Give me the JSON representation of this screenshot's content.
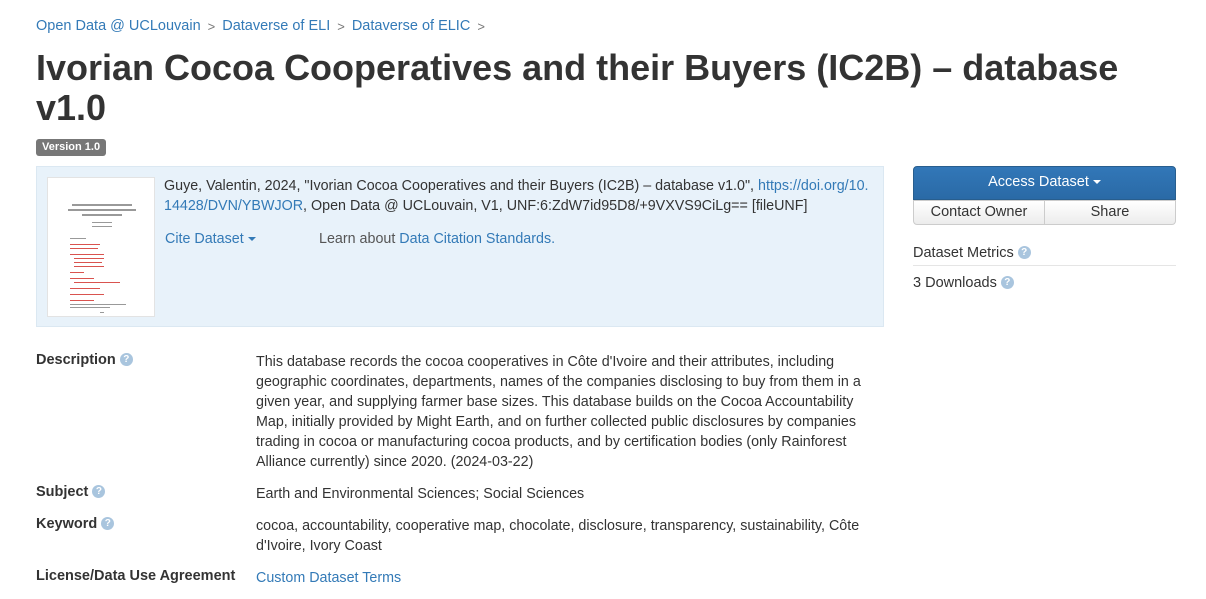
{
  "breadcrumb": [
    {
      "label": "Open Data @ UCLouvain"
    },
    {
      "label": "Dataverse of ELI"
    },
    {
      "label": "Dataverse of ELIC"
    }
  ],
  "breadcrumb_separator": ">",
  "title": "Ivorian Cocoa Cooperatives and their Buyers (IC2B) – database v1.0",
  "version_badge": "Version 1.0",
  "citation": {
    "text_before": "Guye, Valentin, 2024, \"Ivorian Cocoa Cooperatives and their Buyers (IC2B) – database v1.0\", ",
    "doi_link": "https://doi.org/10.14428/DVN/YBWJOR",
    "text_after": ", Open Data @ UCLouvain, V1, UNF:6:ZdW7id95D8/+9VXVS9CiLg== [fileUNF]",
    "cite_button": "Cite Dataset",
    "learn_prefix": "Learn about ",
    "learn_link": "Data Citation Standards."
  },
  "sidebar": {
    "access_button": "Access Dataset",
    "contact_button": "Contact Owner",
    "share_button": "Share",
    "metrics_title": "Dataset Metrics",
    "downloads": "3 Downloads"
  },
  "help_glyph": "?",
  "metadata": {
    "description_label": "Description",
    "description_value": "This database records the cocoa cooperatives in Côte d'Ivoire and their attributes, including geographic coordinates, departments, names of the companies disclosing to buy from them in a given year, and supplying farmer base sizes. This database builds on the Cocoa Accountability Map, initially provided by Might Earth, and on further collected public disclosures by companies trading in cocoa or manufacturing cocoa products, and by certification bodies (only Rainforest Alliance currently) since 2020. (2024-03-22)",
    "subject_label": "Subject",
    "subject_value": "Earth and Environmental Sciences; Social Sciences",
    "keyword_label": "Keyword",
    "keyword_value": "cocoa, accountability, cooperative map, chocolate, disclosure, transparency, sustainability, Côte d'Ivoire, Ivory Coast",
    "license_label": "License/Data Use Agreement",
    "license_value": "Custom Dataset Terms"
  },
  "colors": {
    "link": "#337ab7",
    "primary_button": "#2a6aa6",
    "citation_background": "#e8f2fa",
    "badge": "#777777"
  }
}
